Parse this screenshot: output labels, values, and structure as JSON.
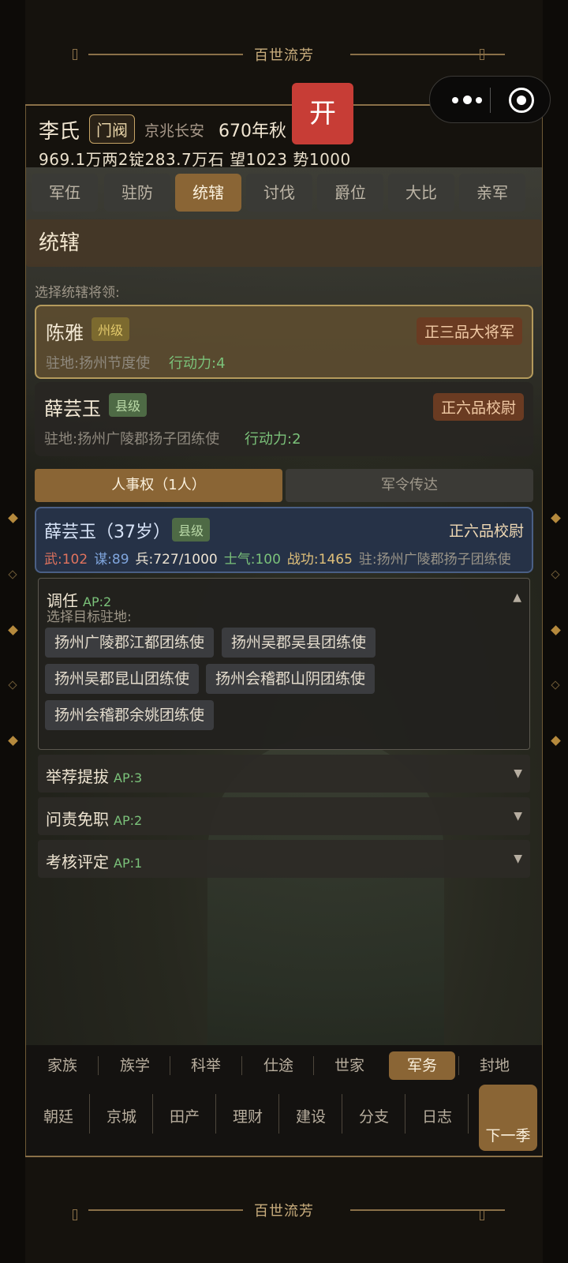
{
  "banner_title": "百世流芳",
  "header": {
    "family": "李氏",
    "rank": "门阀",
    "place": "京兆长安",
    "date": "670年秋",
    "stats": "969.1万两2锭283.7万石 望1023 势1000"
  },
  "open_button": "开",
  "tabs": [
    "军伍",
    "驻防",
    "统辖",
    "讨伐",
    "爵位",
    "大比",
    "亲军"
  ],
  "active_tab": "统辖",
  "section_title": "统辖",
  "select_hint": "选择统辖将领:",
  "generals": [
    {
      "name": "陈雅",
      "level": "州级",
      "rank": "正三品大将军",
      "station": "驻地:扬州节度使",
      "ap": "行动力:4"
    },
    {
      "name": "薛芸玉",
      "level": "县级",
      "rank": "正六品校尉",
      "station": "驻地:扬州广陵郡扬子团练使",
      "ap": "行动力:2"
    }
  ],
  "subtabs": {
    "personnel": "人事权（1人）",
    "orders": "军令传达"
  },
  "person": {
    "name": "薛芸玉（37岁）",
    "level": "县级",
    "rank": "正六品校尉",
    "wu": "武:102",
    "mou": "谋:89",
    "bing": "兵:727/1000",
    "shiqi": "士气:100",
    "zhangong": "战功:1465",
    "station": "驻:扬州广陵郡扬子团练使"
  },
  "panels": {
    "transfer": {
      "title": "调任",
      "ap": "AP:2",
      "hint": "选择目标驻地:",
      "options": [
        "扬州广陵郡江都团练使",
        "扬州吴郡吴县团练使",
        "扬州吴郡昆山团练使",
        "扬州会稽郡山阴团练使",
        "扬州会稽郡余姚团练使"
      ]
    },
    "recommend": {
      "title": "举荐提拔",
      "ap": "AP:3"
    },
    "dismiss": {
      "title": "问责免职",
      "ap": "AP:2"
    },
    "assess": {
      "title": "考核评定",
      "ap": "AP:1"
    }
  },
  "nav_row1": [
    "家族",
    "族学",
    "科举",
    "仕途",
    "世家",
    "军务",
    "封地"
  ],
  "nav_row1_active": "军务",
  "nav_row2": [
    "朝廷",
    "京城",
    "田产",
    "理财",
    "建设",
    "分支",
    "日志"
  ],
  "next_season": "下一季",
  "colors": {
    "accent": "#8a6535",
    "ap_green": "#7bc27a",
    "open_red": "#c73d36"
  }
}
